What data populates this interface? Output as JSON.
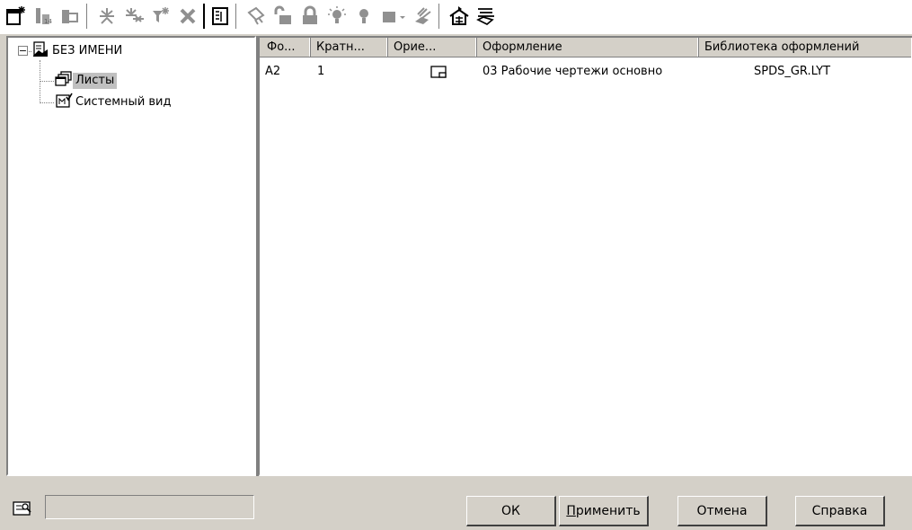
{
  "toolbar": {
    "icons": [
      "new-sheet-icon",
      "sheet-properties-icon",
      "sheet-view-icon",
      "star-icon",
      "multi-star-icon",
      "filter-icon",
      "delete-icon",
      "table-view-icon",
      "brush-icon",
      "unlock-icon",
      "lock-icon",
      "light-on-icon",
      "light-off-icon",
      "color-icon",
      "dropdown-arrow-icon",
      "layer-style-icon",
      "layer-move-icon",
      "layer-list-icon"
    ]
  },
  "tree": {
    "root_label": "БЕЗ ИМЕНИ",
    "expander": "−",
    "children": [
      {
        "label": "Листы",
        "selected": true
      },
      {
        "label": "Системный вид",
        "selected": false
      }
    ]
  },
  "list": {
    "columns": [
      "Фо...",
      "Кратн...",
      "Орие...",
      "Оформление",
      "Библиотека оформлений"
    ],
    "rows": [
      {
        "format": "A2",
        "scale": "1",
        "orientation_icon": "landscape-icon",
        "design": "03 Рабочие чертежи основно",
        "library": "SPDS_GR.LYT"
      }
    ]
  },
  "status": {
    "field_value": ""
  },
  "buttons": {
    "ok": "ОК",
    "apply_first": "П",
    "apply_rest": "рименить",
    "cancel": "Отмена",
    "help": "Справка"
  }
}
